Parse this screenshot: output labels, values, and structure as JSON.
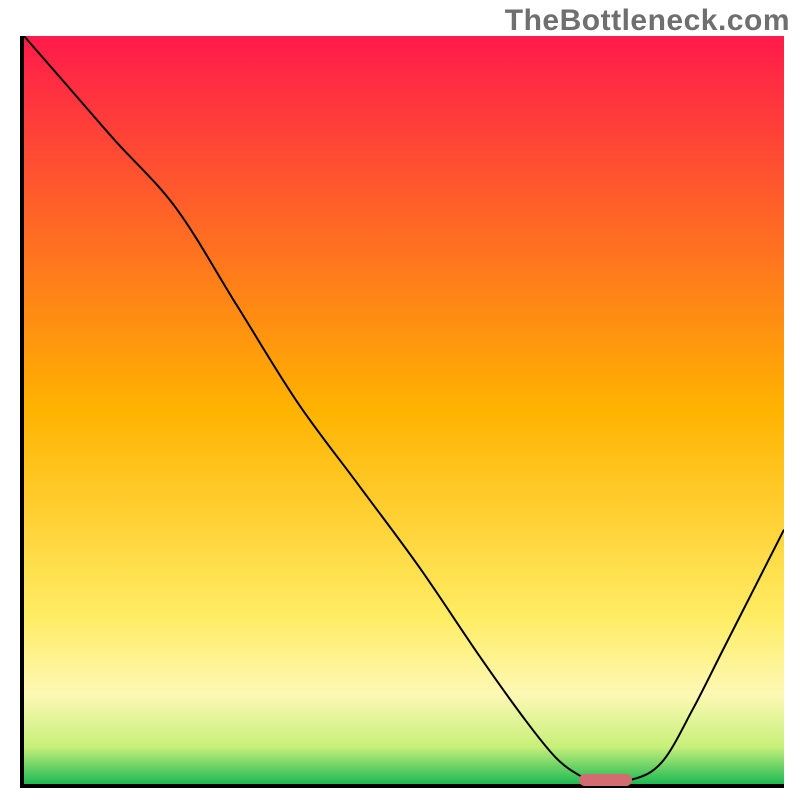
{
  "watermark": "TheBottleneck.com",
  "chart_data": {
    "type": "line",
    "title": "",
    "xlabel": "",
    "ylabel": "",
    "xlim": [
      0,
      100
    ],
    "ylim": [
      0,
      100
    ],
    "grid": false,
    "legend": false,
    "background_gradient": {
      "stops": [
        {
          "offset": 0.0,
          "color": "#ff1a4b"
        },
        {
          "offset": 0.5,
          "color": "#ffb300"
        },
        {
          "offset": 0.78,
          "color": "#ffed66"
        },
        {
          "offset": 0.88,
          "color": "#fdf8b5"
        },
        {
          "offset": 0.95,
          "color": "#c8f07a"
        },
        {
          "offset": 1.0,
          "color": "#1db954"
        }
      ]
    },
    "series": [
      {
        "name": "curve",
        "stroke": "#000000",
        "stroke_width": 2,
        "x": [
          0,
          6,
          12,
          20,
          28,
          36,
          44,
          52,
          60,
          66,
          70,
          73,
          75,
          80,
          84,
          88,
          92,
          96,
          100
        ],
        "y": [
          100,
          93,
          86,
          77,
          64,
          51,
          40,
          29,
          17,
          8.5,
          3.5,
          1.2,
          0.6,
          0.6,
          3,
          10,
          18,
          26,
          34
        ]
      }
    ],
    "marker": {
      "name": "optimal-range",
      "color": "#d36b72",
      "x_start": 73,
      "x_end": 80,
      "y": 0.6
    }
  }
}
